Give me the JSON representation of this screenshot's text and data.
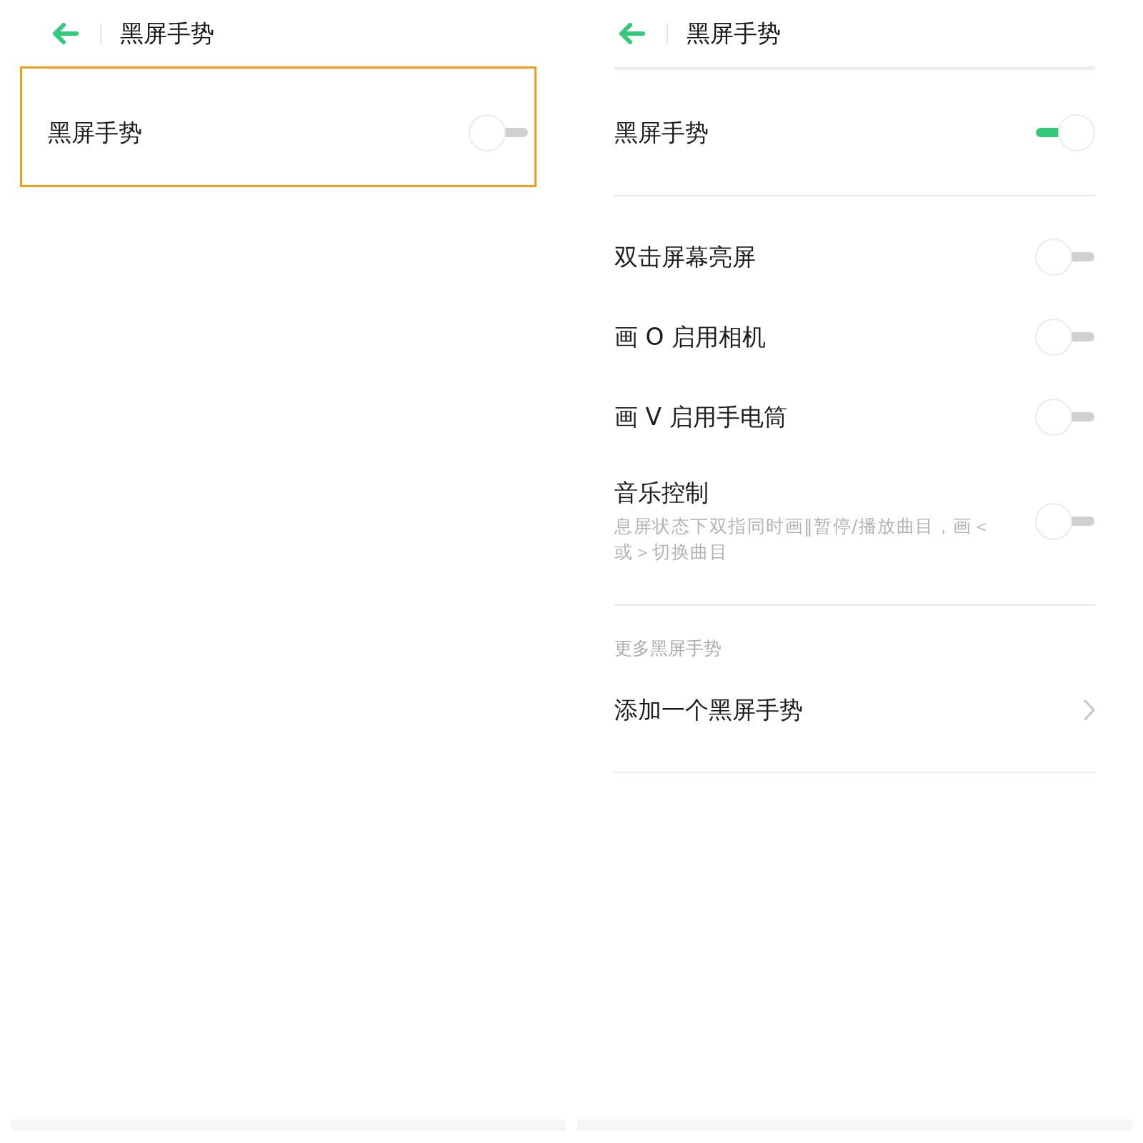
{
  "panels": [
    {
      "header": {
        "title": "黑屏手势"
      },
      "highlight": true,
      "sections": [
        {
          "items": [
            {
              "kind": "toggle",
              "label": "黑屏手势",
              "on": false
            }
          ]
        }
      ]
    },
    {
      "header": {
        "title": "黑屏手势"
      },
      "sections": [
        {
          "items": [
            {
              "kind": "toggle",
              "label": "黑屏手势",
              "on": true
            }
          ]
        },
        {
          "items": [
            {
              "kind": "toggle",
              "label": "双击屏幕亮屏",
              "on": false
            },
            {
              "kind": "toggle",
              "label": "画 O 启用相机",
              "on": false
            },
            {
              "kind": "toggle",
              "label": "画 V 启用手电筒",
              "on": false
            },
            {
              "kind": "toggle",
              "label": "音乐控制",
              "description": "息屏状态下双指同时画‖暂停/播放曲目，画＜或＞切换曲目",
              "on": false
            }
          ]
        },
        {
          "heading": "更多黑屏手势",
          "items": [
            {
              "kind": "link",
              "label": "添加一个黑屏手势"
            }
          ]
        }
      ]
    }
  ]
}
